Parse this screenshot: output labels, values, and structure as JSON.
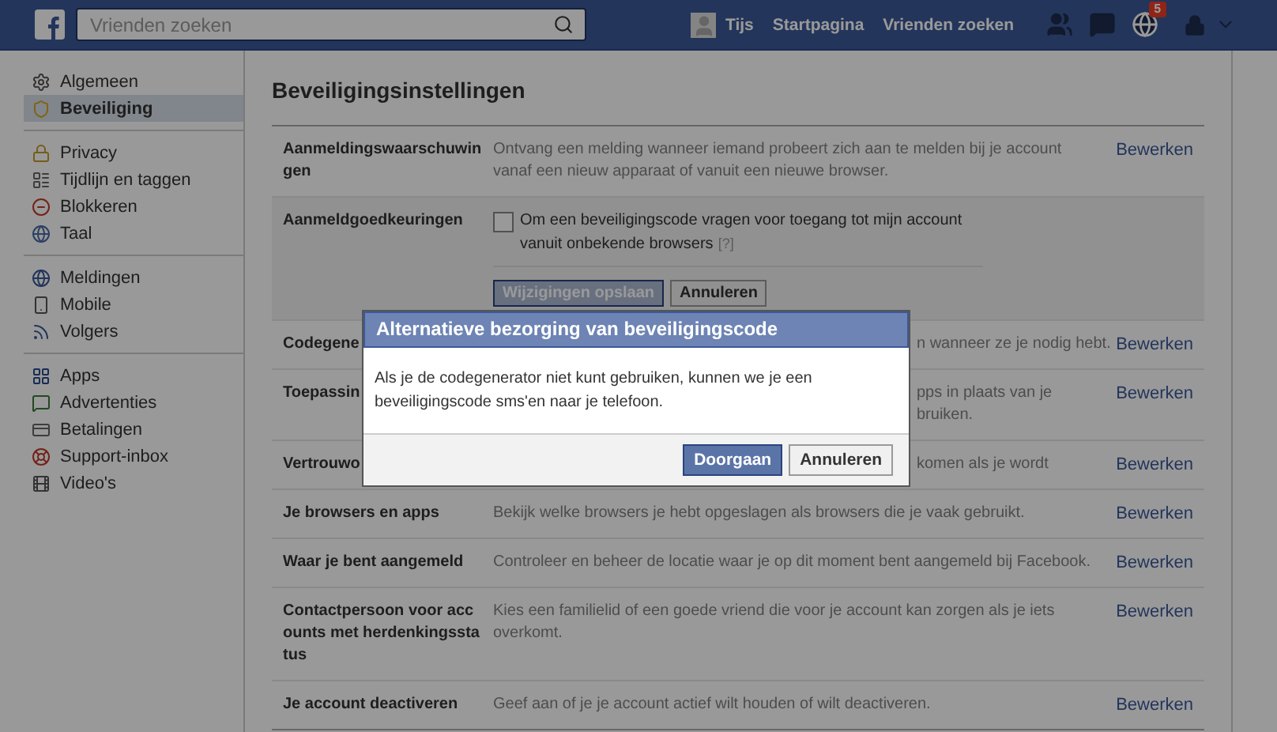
{
  "top_bar": {
    "search": {
      "placeholder": "Vrienden zoeken"
    },
    "user": "Tijs",
    "links": [
      "Startpagina",
      "Vrienden zoeken"
    ],
    "notifications_badge": "5"
  },
  "sidebar": {
    "groups": [
      [
        {
          "label": "Algemeen",
          "selected": false
        },
        {
          "label": "Beveiliging",
          "selected": true
        }
      ],
      [
        {
          "label": "Privacy",
          "selected": false
        },
        {
          "label": "Tijdlijn en taggen",
          "selected": false
        },
        {
          "label": "Blokkeren",
          "selected": false
        },
        {
          "label": "Taal",
          "selected": false
        }
      ],
      [
        {
          "label": "Meldingen",
          "selected": false
        },
        {
          "label": "Mobile",
          "selected": false
        },
        {
          "label": "Volgers",
          "selected": false
        }
      ],
      [
        {
          "label": "Apps",
          "selected": false
        },
        {
          "label": "Advertenties",
          "selected": false
        },
        {
          "label": "Betalingen",
          "selected": false
        },
        {
          "label": "Support-inbox",
          "selected": false
        },
        {
          "label": "Video's",
          "selected": false
        }
      ]
    ]
  },
  "page_title": "Beveiligingsinstellingen",
  "rows": [
    {
      "kind": "setting",
      "label": "Aanmeldingswaarschuwingen",
      "description": "Ontvang een melding wanneer iemand probeert zich aan te melden bij je account vanaf een nieuw apparaat of vanuit een nieuwe browser.",
      "edit": "Bewerken"
    },
    {
      "kind": "expanded",
      "label": "Aanmeldgoedkeuringen",
      "checkbox": {
        "label": "Om een beveiligingscode vragen voor toegang tot mijn account vanuit onbekende browsers",
        "help": "[?]",
        "checked": false
      },
      "save": {
        "label": "Wijzigingen opslaan",
        "disabled": true
      },
      "cancel": "Annuleren"
    },
    {
      "kind": "covered",
      "label": "Codegene",
      "description": "n wanneer ze je nodig hebt.",
      "edit": "Bewerken"
    },
    {
      "kind": "covered",
      "label": "Toepassin",
      "description": "pps in plaats van je\nbruiken.",
      "edit": "Bewerken"
    },
    {
      "kind": "covered",
      "label": "Vertrouwo",
      "description": "komen als je wordt",
      "edit": "Bewerken"
    },
    {
      "kind": "setting",
      "label": "Je browsers en apps",
      "description": "Bekijk welke browsers je hebt opgeslagen als browsers die je vaak gebruikt.",
      "edit": "Bewerken"
    },
    {
      "kind": "setting",
      "label": "Waar je bent aangemeld",
      "description": "Controleer en beheer de locatie waar je op dit moment bent aangemeld bij Facebook.",
      "edit": "Bewerken"
    },
    {
      "kind": "setting",
      "label": "Contactpersoon voor accounts met herdenkingsstatus",
      "description": "Kies een familielid of een goede vriend die voor je account kan zorgen als je iets overkomt.",
      "edit": "Bewerken"
    },
    {
      "kind": "setting",
      "label": "Je account deactiveren",
      "description": "Geef aan of je je account actief wilt houden of wilt deactiveren.",
      "edit": "Bewerken"
    }
  ],
  "dialog": {
    "title": "Alternatieve bezorging van beveiligingscode",
    "message": "Als je de codegenerator niet kunt gebruiken, kunnen we je een beveiligingscode sms'en naar je telefoon.",
    "buttons": [
      {
        "label": "Doorgaan",
        "primary": true
      },
      {
        "label": "Annuleren",
        "primary": false
      }
    ]
  }
}
